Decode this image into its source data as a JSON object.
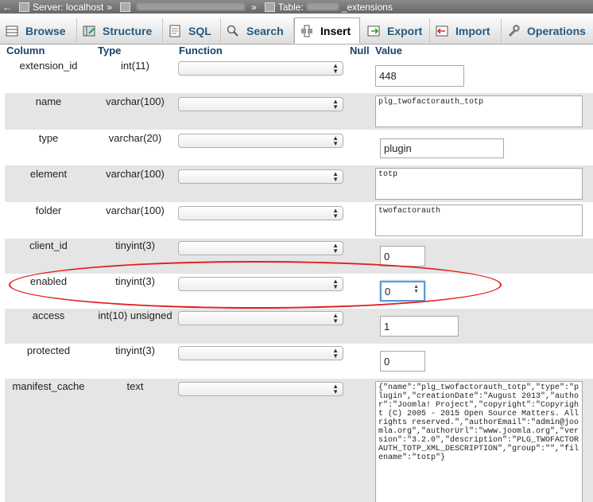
{
  "breadcrumb": {
    "back": "←",
    "server": "Server: localhost",
    "sep": "»",
    "table": "Table:",
    "table_suffix": "_extensions"
  },
  "tabs": [
    {
      "label": "Browse",
      "icon": "browse-icon"
    },
    {
      "label": "Structure",
      "icon": "structure-icon"
    },
    {
      "label": "SQL",
      "icon": "sql-icon"
    },
    {
      "label": "Search",
      "icon": "search-icon"
    },
    {
      "label": "Insert",
      "icon": "insert-icon"
    },
    {
      "label": "Export",
      "icon": "export-icon"
    },
    {
      "label": "Import",
      "icon": "import-icon"
    },
    {
      "label": "Operations",
      "icon": "wrench-icon"
    }
  ],
  "header": {
    "column": "Column",
    "type": "Type",
    "function": "Function",
    "null": "Null",
    "value": "Value"
  },
  "rows": [
    {
      "column": "extension_id",
      "type": "int(11)",
      "value": "448"
    },
    {
      "column": "name",
      "type": "varchar(100)",
      "value": "plg_twofactorauth_totp"
    },
    {
      "column": "type",
      "type": "varchar(20)",
      "value": "plugin"
    },
    {
      "column": "element",
      "type": "varchar(100)",
      "value": "totp"
    },
    {
      "column": "folder",
      "type": "varchar(100)",
      "value": "twofactorauth"
    },
    {
      "column": "client_id",
      "type": "tinyint(3)",
      "value": "0"
    },
    {
      "column": "enabled",
      "type": "tinyint(3)",
      "value": "0"
    },
    {
      "column": "access",
      "type": "int(10) unsigned",
      "value": "1"
    },
    {
      "column": "protected",
      "type": "tinyint(3)",
      "value": "0"
    },
    {
      "column": "manifest_cache",
      "type": "text",
      "value": "{\"name\":\"plg_twofactorauth_totp\",\"type\":\"plugin\",\"creationDate\":\"August 2013\",\"author\":\"Joomla! Project\",\"copyright\":\"Copyright (C) 2005 - 2015 Open Source Matters. All rights reserved.\",\"authorEmail\":\"admin@joomla.org\",\"authorUrl\":\"www.joomla.org\",\"version\":\"3.2.0\",\"description\":\"PLG_TWOFACTORAUTH_TOTP_XML_DESCRIPTION\",\"group\":\"\",\"filename\":\"totp\"}"
    }
  ],
  "colors": {
    "link": "#235a81",
    "highlight": "#e21d1d",
    "row_alt": "#e5e5e5"
  }
}
